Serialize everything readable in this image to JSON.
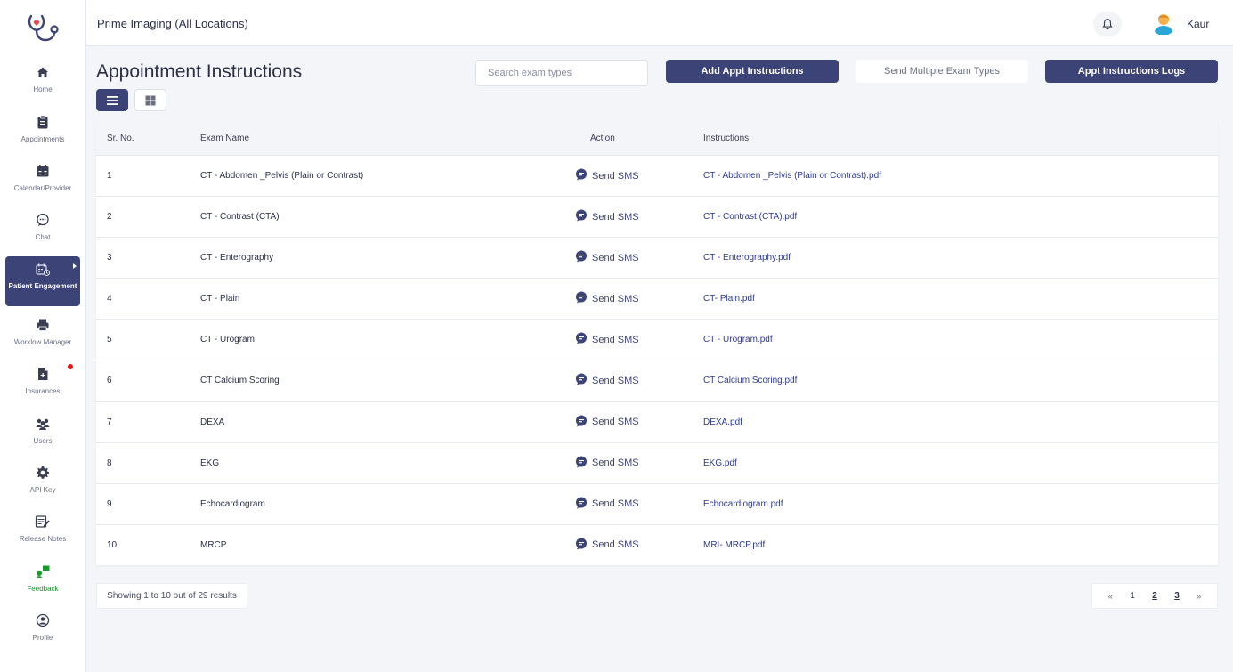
{
  "header": {
    "org_title": "Prime Imaging (All Locations)",
    "user_name": "Kaur"
  },
  "sidebar": {
    "items": [
      {
        "label": "Home",
        "icon": "home-icon"
      },
      {
        "label": "Appointments",
        "icon": "clipboard-icon"
      },
      {
        "label": "Calendar/Provider",
        "icon": "calendar-icon"
      },
      {
        "label": "Chat",
        "icon": "chat-icon"
      },
      {
        "label": "Patient Engagement",
        "icon": "patient-engagement-icon",
        "active": true
      },
      {
        "label": "Worklow Manager",
        "icon": "printer-icon"
      },
      {
        "label": "Insurances",
        "icon": "document-icon",
        "badge_dot": true
      },
      {
        "label": "Users",
        "icon": "users-icon"
      },
      {
        "label": "API Key",
        "icon": "gear-icon"
      },
      {
        "label": "Release Notes",
        "icon": "notes-icon"
      },
      {
        "label": "Feedback",
        "icon": "feedback-icon"
      },
      {
        "label": "Profile",
        "icon": "profile-icon"
      }
    ]
  },
  "page": {
    "title": "Appointment Instructions",
    "search_placeholder": "Search exam types",
    "add_button": "Add Appt Instructions",
    "multi_button": "Send Multiple Exam Types",
    "logs_button": "Appt Instructions Logs"
  },
  "table": {
    "headers": {
      "sr": "Sr. No.",
      "name": "Exam Name",
      "action": "Action",
      "instructions": "Instructions"
    },
    "action_label": "Send SMS",
    "rows": [
      {
        "sr": "1",
        "name": "CT - Abdomen _Pelvis (Plain or Contrast)",
        "file": "CT - Abdomen _Pelvis (Plain or Contrast).pdf"
      },
      {
        "sr": "2",
        "name": "CT - Contrast (CTA)",
        "file": "CT - Contrast (CTA).pdf"
      },
      {
        "sr": "3",
        "name": "CT - Enterography",
        "file": "CT - Enterography.pdf"
      },
      {
        "sr": "4",
        "name": "CT - Plain",
        "file": "CT- Plain.pdf"
      },
      {
        "sr": "5",
        "name": "CT - Urogram",
        "file": "CT - Urogram.pdf"
      },
      {
        "sr": "6",
        "name": "CT Calcium Scoring",
        "file": "CT Calcium Scoring.pdf"
      },
      {
        "sr": "7",
        "name": "DEXA",
        "file": "DEXA.pdf"
      },
      {
        "sr": "8",
        "name": "EKG",
        "file": "EKG.pdf"
      },
      {
        "sr": "9",
        "name": "Echocardiogram",
        "file": "Echocardiogram.pdf"
      },
      {
        "sr": "10",
        "name": "MRCP",
        "file": "MRI- MRCP.pdf"
      }
    ]
  },
  "footer": {
    "results_text": "Showing 1 to 10 out of 29 results",
    "pagination": {
      "prev": "«",
      "pages": [
        "1",
        "2",
        "3"
      ],
      "next": "»"
    }
  },
  "colors": {
    "primary": "#3c4376",
    "link": "#2e3a8c",
    "feedback": "#1b8a2a",
    "alert": "#e01515"
  }
}
